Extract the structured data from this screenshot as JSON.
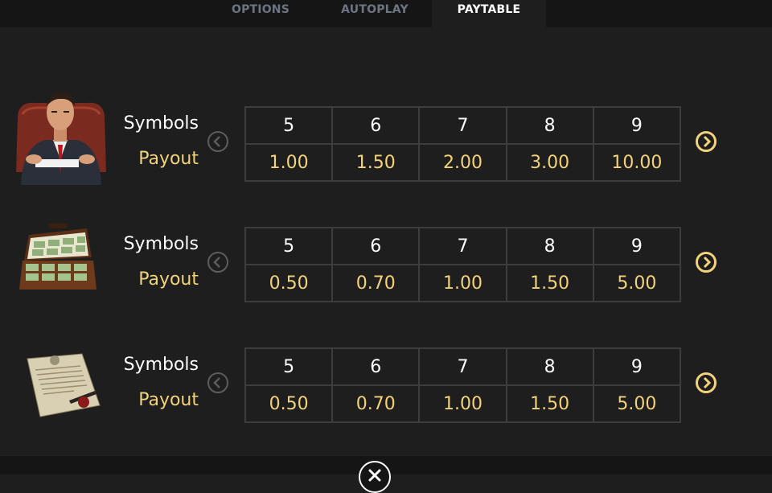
{
  "tabs": [
    {
      "label": "OPTIONS",
      "active": false
    },
    {
      "label": "AUTOPLAY",
      "active": false
    },
    {
      "label": "PAYTABLE",
      "active": true
    }
  ],
  "labels": {
    "symbols": "Symbols",
    "payout": "Payout"
  },
  "paytable": [
    {
      "symbol_icon": "mob-boss-icon",
      "counts": [
        "5",
        "6",
        "7",
        "8",
        "9"
      ],
      "payouts": [
        "1.00",
        "1.50",
        "2.00",
        "3.00",
        "10.00"
      ]
    },
    {
      "symbol_icon": "money-briefcase-icon",
      "counts": [
        "5",
        "6",
        "7",
        "8",
        "9"
      ],
      "payouts": [
        "0.50",
        "0.70",
        "1.00",
        "1.50",
        "5.00"
      ]
    },
    {
      "symbol_icon": "contract-document-icon",
      "counts": [
        "5",
        "6",
        "7",
        "8",
        "9"
      ],
      "payouts": [
        "0.50",
        "0.70",
        "1.00",
        "1.50",
        "5.00"
      ]
    }
  ],
  "colors": {
    "background": "#1e1e1e",
    "panel": "#151515",
    "accent": "#f2d27a",
    "grid": "#3d3d3d",
    "inactive_tab": "#6d7582"
  },
  "icons": {
    "prev": "chevron-left-icon",
    "next": "chevron-right-icon",
    "close": "close-icon"
  }
}
